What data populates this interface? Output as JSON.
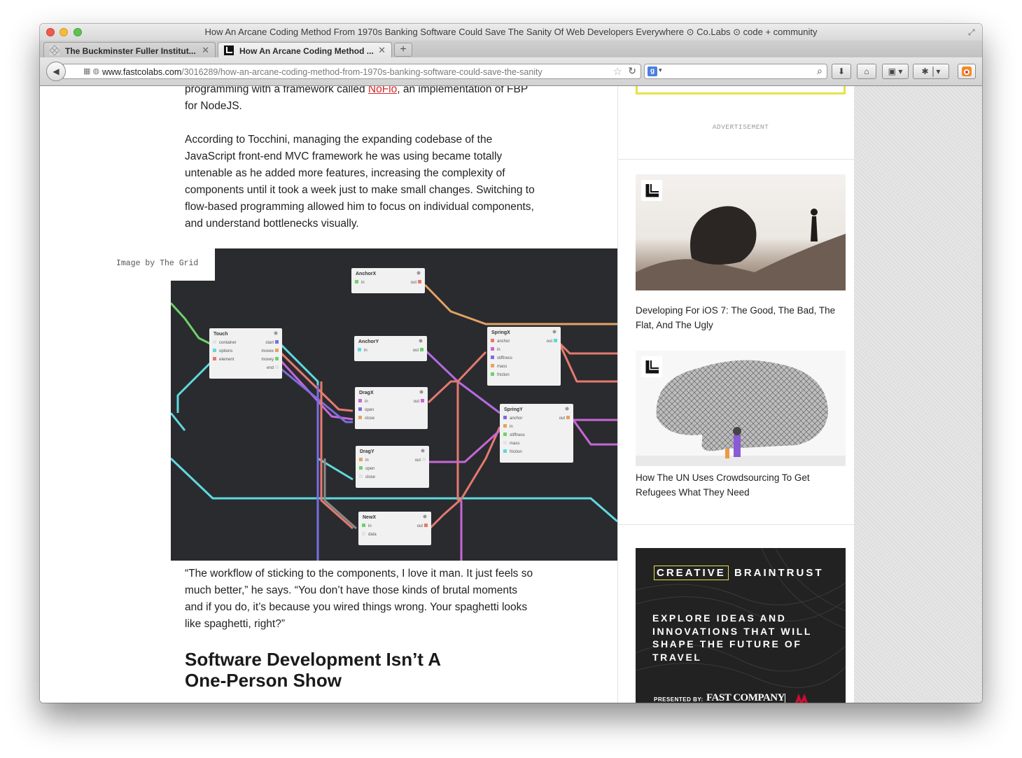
{
  "window": {
    "title": "How An Arcane Coding Method From 1970s Banking Software Could Save The Sanity Of Web Developers Everywhere ⊙ Co.Labs ⊙ code + community"
  },
  "tabs": [
    {
      "label": "The Buckminster Fuller Institut...",
      "active": false
    },
    {
      "label": "How An Arcane Coding Method ...",
      "active": true
    }
  ],
  "navbar": {
    "url_host": "www.fastcolabs.com",
    "url_path": "/3016289/how-an-arcane-coding-method-from-1970s-banking-software-could-save-the-sanity",
    "search_value": "",
    "search_engine_icon": "g-icon"
  },
  "article": {
    "p1_prefix": "programming with a framework called ",
    "p1_link": "NoFlo",
    "p1_suffix": ", an implementation of FBP for NodeJS.",
    "p2": "According to Tocchini, managing the expanding codebase of the JavaScript front-end MVC framework he was using became totally untenable as he added more features, increasing the complexity of components until it took a week just to make small changes. Switching to flow-based programming allowed him to focus on individual components, and understand bottlenecks visually.",
    "image_caption": "Image by The Grid",
    "p3": "“The workflow of sticking to the components, I love it man. It just feels so much better,” he says. “You don’t have those kinds of brutal moments and if you do, it’s because you wired things wrong. Your spaghetti looks like spaghetti, right?”",
    "h2": "Software Development Isn’t A One-Person Show"
  },
  "graph": {
    "background": "#2a2b2f",
    "nodes": [
      {
        "title": "AnchorX",
        "ports_in": [
          "in"
        ],
        "ports_out": [
          "out"
        ]
      },
      {
        "title": "Touch",
        "ports_in": [
          "container",
          "options",
          "element"
        ],
        "ports_out": [
          "start",
          "movex",
          "movey",
          "end"
        ]
      },
      {
        "title": "AnchorY",
        "ports_in": [
          "in"
        ],
        "ports_out": [
          "out"
        ]
      },
      {
        "title": "SpringX",
        "ports_in": [
          "anchor",
          "in",
          "stiffness",
          "mass",
          "friction"
        ],
        "ports_out": [
          "out"
        ]
      },
      {
        "title": "DragX",
        "ports_in": [
          "in",
          "open",
          "close"
        ],
        "ports_out": [
          "out"
        ]
      },
      {
        "title": "SpringY",
        "ports_in": [
          "anchor",
          "in",
          "stiffness",
          "mass",
          "friction"
        ],
        "ports_out": [
          "out"
        ]
      },
      {
        "title": "DragY",
        "ports_in": [
          "in",
          "open",
          "close"
        ],
        "ports_out": [
          "out"
        ]
      },
      {
        "title": "NewX",
        "ports_in": [
          "in",
          "data"
        ],
        "ports_out": [
          "out"
        ]
      }
    ]
  },
  "sidebar": {
    "ad_label": "ADVERTISEMENT",
    "stories": [
      {
        "title": "Developing For iOS 7: The Good, The Bad, The Flat, And The Ugly"
      },
      {
        "title": "How The UN Uses Crowdsourcing To Get Refugees What They Need"
      }
    ],
    "braintrust": {
      "creative": "CREATIVE",
      "braintrust": "BRAINTRUST",
      "body": "EXPLORE IDEAS AND INNOVATIONS THAT WILL SHAPE THE FUTURE OF TRAVEL",
      "presented_by": "PRESENTED BY:",
      "sponsor": "FAST COMPANY",
      "accent": "#e6e24a"
    }
  }
}
